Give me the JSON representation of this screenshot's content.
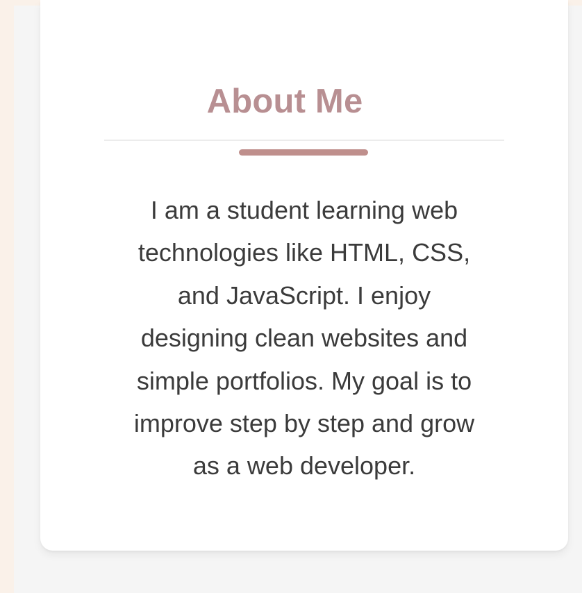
{
  "about": {
    "title": "About Me",
    "lines": [
      "I am a student learning web",
      "technologies like HTML, CSS,",
      "and JavaScript. I enjoy",
      "designing clean websites and",
      "simple portfolios. My goal is to",
      "improve step by step and grow",
      "as a web developer."
    ]
  },
  "colors": {
    "page_background": "#faf1e9",
    "panel_background": "#f5f5f5",
    "card_background": "#ffffff",
    "title": "#b88f92",
    "accent": "#bf8f8c",
    "text": "#3b3b3b",
    "divider": "#ececec"
  }
}
